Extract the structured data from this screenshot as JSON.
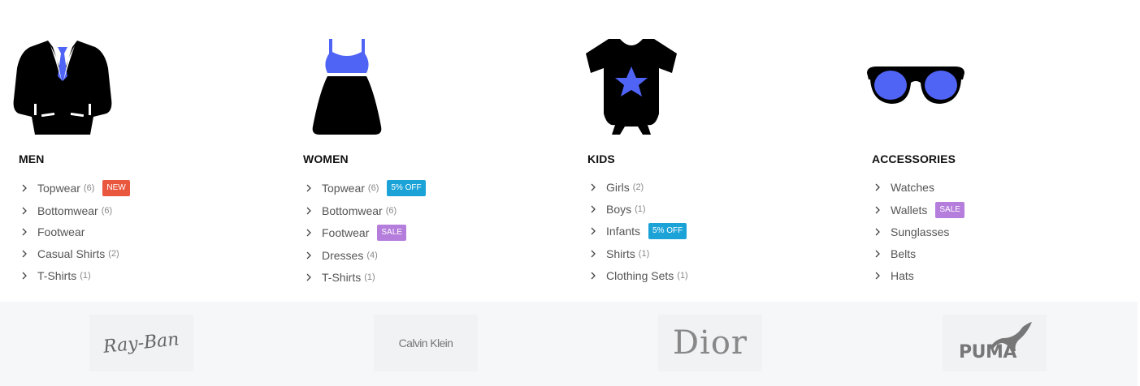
{
  "categories": [
    {
      "title": "MEN",
      "icon": "suit-jacket-icon",
      "items": [
        {
          "label": "Topwear",
          "count": "(6)",
          "badge": "NEW",
          "badge_color": "#e9573f"
        },
        {
          "label": "Bottomwear",
          "count": "(6)",
          "badge": "",
          "badge_color": ""
        },
        {
          "label": "Footwear",
          "count": "",
          "badge": "",
          "badge_color": ""
        },
        {
          "label": "Casual Shirts",
          "count": "(2)",
          "badge": "",
          "badge_color": ""
        },
        {
          "label": "T-Shirts",
          "count": "(1)",
          "badge": "",
          "badge_color": ""
        }
      ]
    },
    {
      "title": "WOMEN",
      "icon": "dress-icon",
      "items": [
        {
          "label": "Topwear",
          "count": "(6)",
          "badge": "5% OFF",
          "badge_color": "#1ba3d8"
        },
        {
          "label": "Bottomwear",
          "count": "(6)",
          "badge": "",
          "badge_color": ""
        },
        {
          "label": "Footwear",
          "count": "",
          "badge": "SALE",
          "badge_color": "#b57edc"
        },
        {
          "label": "Dresses",
          "count": "(4)",
          "badge": "",
          "badge_color": ""
        },
        {
          "label": "T-Shirts",
          "count": "(1)",
          "badge": "",
          "badge_color": ""
        }
      ]
    },
    {
      "title": "KIDS",
      "icon": "baby-onesie-icon",
      "items": [
        {
          "label": "Girls",
          "count": "(2)",
          "badge": "",
          "badge_color": ""
        },
        {
          "label": "Boys",
          "count": "(1)",
          "badge": "",
          "badge_color": ""
        },
        {
          "label": "Infants",
          "count": "",
          "badge": "5% OFF",
          "badge_color": "#1ba3d8"
        },
        {
          "label": "Shirts",
          "count": "(1)",
          "badge": "",
          "badge_color": ""
        },
        {
          "label": "Clothing Sets",
          "count": "(1)",
          "badge": "",
          "badge_color": ""
        }
      ]
    },
    {
      "title": "ACCESSORIES",
      "icon": "sunglasses-icon",
      "items": [
        {
          "label": "Watches",
          "count": "",
          "badge": "",
          "badge_color": ""
        },
        {
          "label": "Wallets",
          "count": "",
          "badge": "SALE",
          "badge_color": "#b57edc"
        },
        {
          "label": "Sunglasses",
          "count": "",
          "badge": "",
          "badge_color": ""
        },
        {
          "label": "Belts",
          "count": "",
          "badge": "",
          "badge_color": ""
        },
        {
          "label": "Hats",
          "count": "",
          "badge": "",
          "badge_color": ""
        }
      ]
    }
  ],
  "brands": {
    "rayban": "Ray-Ban",
    "calvin_klein": "Calvin Klein",
    "dior": "Dior",
    "puma": "PUMA"
  },
  "colors": {
    "icon_accent": "#4f63f5",
    "icon_dark": "#000000",
    "brand_bar_bg": "#f6f7f9"
  }
}
